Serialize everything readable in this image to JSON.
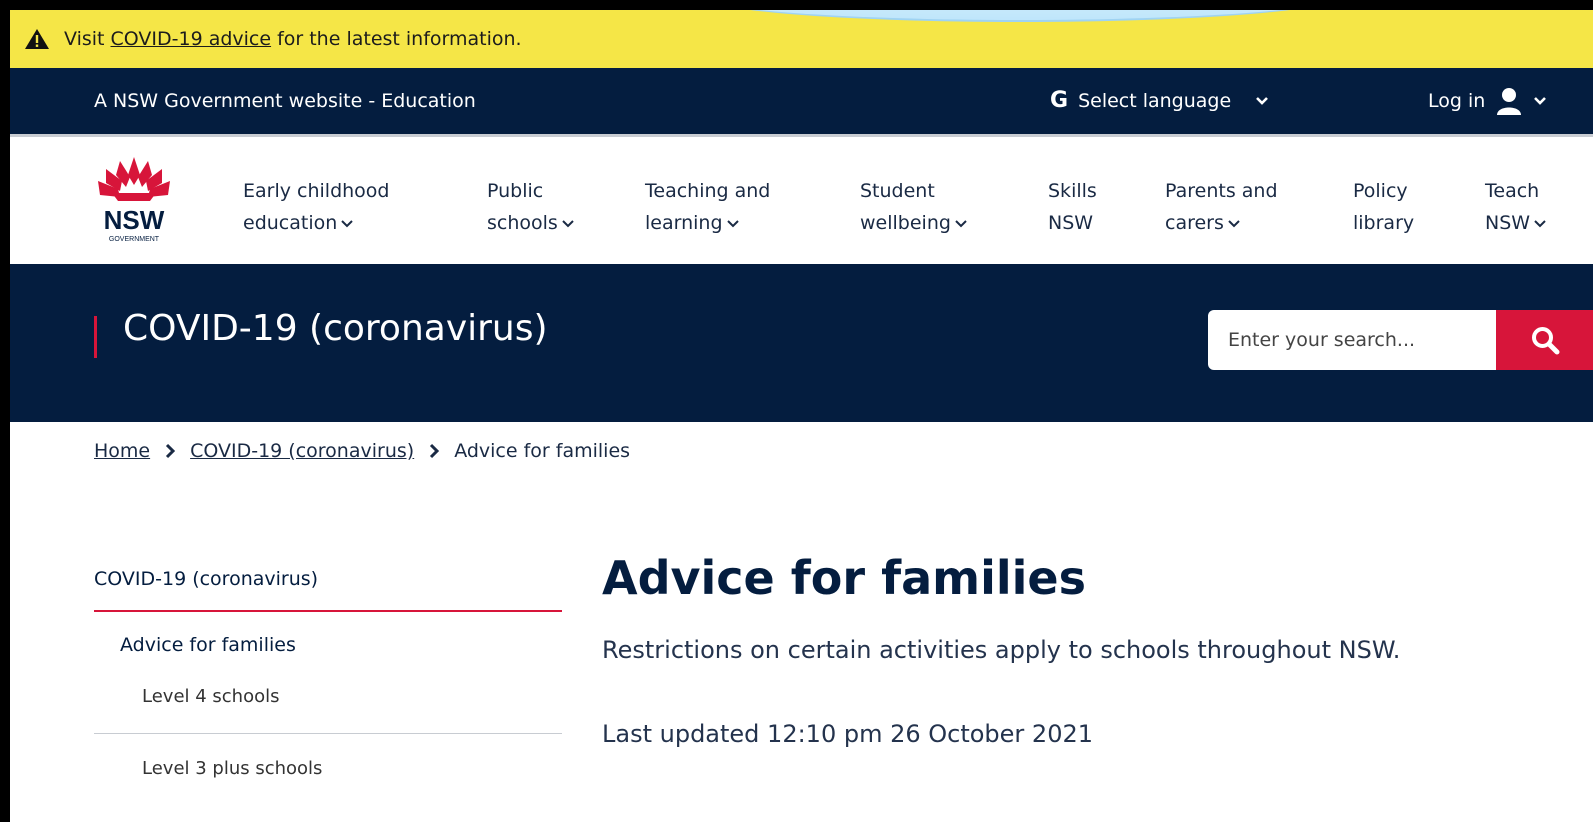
{
  "alert": {
    "prefix": "Visit",
    "link": "COVID-19 advice",
    "suffix": "for the latest information.",
    "icon": "warning-triangle-icon"
  },
  "masthead": {
    "site_label": "A NSW Government website - Education",
    "language_label": "Select language",
    "language_icon": "G",
    "login_label": "Log in"
  },
  "logo": {
    "text": "NSW",
    "subtext": "GOVERNMENT",
    "color": "#d7153a"
  },
  "nav": {
    "items": [
      {
        "line1": "Early childhood",
        "line2": "education",
        "has_dropdown": true
      },
      {
        "line1": "Public",
        "line2": "schools",
        "has_dropdown": true
      },
      {
        "line1": "Teaching and",
        "line2": "learning",
        "has_dropdown": true
      },
      {
        "line1": "Student",
        "line2": "wellbeing",
        "has_dropdown": true
      },
      {
        "line1": "Skills",
        "line2": "NSW",
        "has_dropdown": false
      },
      {
        "line1": "Parents and",
        "line2": "carers",
        "has_dropdown": true
      },
      {
        "line1": "Policy",
        "line2": "library",
        "has_dropdown": false
      },
      {
        "line1": "Teach",
        "line2": "NSW",
        "has_dropdown": true
      }
    ]
  },
  "banner": {
    "title": "COVID-19 (coronavirus)",
    "search_placeholder": "Enter your search..."
  },
  "breadcrumb": {
    "home": "Home",
    "section": "COVID-19 (coronavirus)",
    "current": "Advice for families"
  },
  "sidenav": {
    "title": "COVID-19 (coronavirus)",
    "active": "Advice for families",
    "children": [
      "Level 4 schools",
      "Level 3 plus schools"
    ]
  },
  "main": {
    "heading": "Advice for families",
    "lead": "Restrictions on certain activities apply to schools throughout NSW.",
    "updated": "Last updated 12:10 pm 26 October 2021"
  },
  "colors": {
    "navy": "#041d3f",
    "red": "#d7153a",
    "alert_yellow": "#f5e647"
  }
}
